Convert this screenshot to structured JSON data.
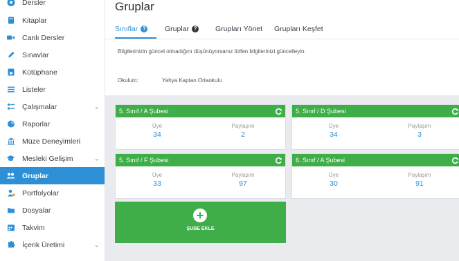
{
  "sidebar": {
    "items": [
      {
        "label": "Dersler",
        "icon": "circle-icon",
        "expandable": false,
        "active": false
      },
      {
        "label": "Kitaplar",
        "icon": "book-icon",
        "expandable": false,
        "active": false
      },
      {
        "label": "Canlı Dersler",
        "icon": "video-camera-icon",
        "expandable": false,
        "active": false
      },
      {
        "label": "Sınavlar",
        "icon": "pencil-icon",
        "expandable": false,
        "active": false
      },
      {
        "label": "Kütüphane",
        "icon": "library-icon",
        "expandable": false,
        "active": false
      },
      {
        "label": "Listeler",
        "icon": "list-icon",
        "expandable": false,
        "active": false
      },
      {
        "label": "Çalışmalar",
        "icon": "tasks-icon",
        "expandable": true,
        "active": false
      },
      {
        "label": "Raporlar",
        "icon": "pie-chart-icon",
        "expandable": false,
        "active": false
      },
      {
        "label": "Müze Deneyimleri",
        "icon": "museum-icon",
        "expandable": false,
        "active": false
      },
      {
        "label": "Mesleki Gelişim",
        "icon": "graduation-cap-icon",
        "expandable": true,
        "active": false
      },
      {
        "label": "Gruplar",
        "icon": "users-icon",
        "expandable": false,
        "active": true
      },
      {
        "label": "Portfolyolar",
        "icon": "portfolio-user-icon",
        "expandable": false,
        "active": false
      },
      {
        "label": "Dosyalar",
        "icon": "folder-icon",
        "expandable": false,
        "active": false
      },
      {
        "label": "Takvim",
        "icon": "calendar-icon",
        "expandable": false,
        "active": false
      },
      {
        "label": "İçerik Üretimi",
        "icon": "puzzle-icon",
        "expandable": true,
        "active": false
      }
    ]
  },
  "header": {
    "title": "Gruplar"
  },
  "tabs": [
    {
      "label": "Sınıflar",
      "has_help": true,
      "active": true
    },
    {
      "label": "Gruplar",
      "has_help": true,
      "active": false
    },
    {
      "label": "Grupları Yönet",
      "has_help": false,
      "active": false
    },
    {
      "label": "Grupları Keşfet",
      "has_help": false,
      "active": false
    }
  ],
  "info_text": "Bilgilerinizin güncel olmadığını düşünüyorsanız lütfen bilgilerinizi güncelleyin.",
  "school": {
    "label": "Okulum:",
    "name": "Yahya Kaptan Ortaokulu"
  },
  "cards": [
    {
      "title": "5. Sınıf / A Şubesi",
      "members_label": "Üye",
      "members": "34",
      "shares_label": "Paylaşım",
      "shares": "2"
    },
    {
      "title": "5. Sınıf / D Şubesi",
      "members_label": "Üye",
      "members": "34",
      "shares_label": "Paylaşım",
      "shares": "3"
    },
    {
      "title": "5. Sınıf / F Şubesi",
      "members_label": "Üye",
      "members": "33",
      "shares_label": "Paylaşım",
      "shares": "97"
    },
    {
      "title": "6. Sınıf / A Şubesi",
      "members_label": "Üye",
      "members": "30",
      "shares_label": "Paylaşım",
      "shares": "91"
    }
  ],
  "add_branch": {
    "label": "ŞUBE EKLE"
  },
  "colors": {
    "accent": "#2d8fd5",
    "card_header": "#3fae49",
    "area_bg": "#e9ebee"
  }
}
